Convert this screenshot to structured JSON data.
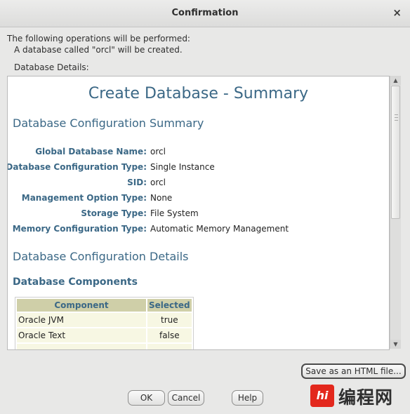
{
  "window": {
    "title": "Confirmation",
    "close_glyph": "×"
  },
  "intro": {
    "line1": "The following operations will be performed:",
    "line2": "A database called \"orcl\" will be created.",
    "details_label": "Database Details:"
  },
  "report": {
    "title": "Create Database - Summary",
    "section_summary": "Database Configuration Summary",
    "fields": [
      {
        "label": "Global Database Name:",
        "value": "orcl"
      },
      {
        "label": "Database Configuration Type:",
        "value": "Single Instance"
      },
      {
        "label": "SID:",
        "value": "orcl"
      },
      {
        "label": "Management Option Type:",
        "value": "None"
      },
      {
        "label": "Storage Type:",
        "value": "File System"
      },
      {
        "label": "Memory Configuration Type:",
        "value": "Automatic Memory Management"
      }
    ],
    "section_details": "Database Configuration Details",
    "section_components": "Database Components",
    "components_table": {
      "headers": [
        "Component",
        "Selected"
      ],
      "rows": [
        [
          "Oracle JVM",
          "true"
        ],
        [
          "Oracle Text",
          "false"
        ]
      ]
    }
  },
  "scrollbar": {
    "up_icon": "▲",
    "down_icon": "▼"
  },
  "buttons": {
    "save_html": "Save as an HTML file...",
    "ok": "OK",
    "cancel": "Cancel",
    "help": "Help"
  },
  "watermark": {
    "logo_text": "hi",
    "text": "编程网"
  },
  "colors": {
    "heading": "#3b6886",
    "table_header": "#cfcfa8",
    "table_cell": "#f7f7e3",
    "watermark_logo": "#e3281d"
  }
}
